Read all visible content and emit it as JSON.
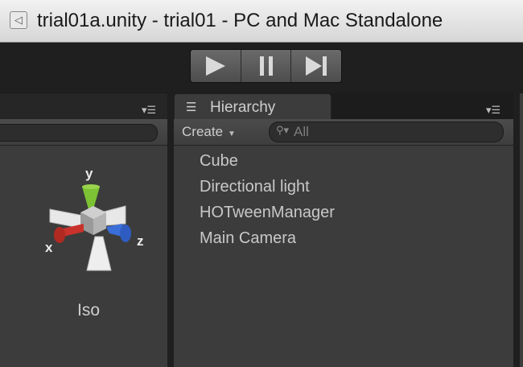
{
  "window": {
    "title": "trial01a.unity - trial01 - PC and Mac Standalone",
    "icon": "unity-document-icon"
  },
  "toolbar": {
    "play_icon": "play-icon",
    "pause_icon": "pause-icon",
    "step_icon": "step-icon"
  },
  "scene": {
    "gizmo_axes": {
      "x": "x",
      "y": "y",
      "z": "z"
    },
    "projection_label": "Iso",
    "axis_colors": {
      "x": "#c8322a",
      "y": "#7cc234",
      "z": "#3a6ed8"
    }
  },
  "hierarchy": {
    "tab_label": "Hierarchy",
    "create_label": "Create",
    "search_placeholder": "All",
    "items": [
      {
        "label": "Cube"
      },
      {
        "label": "Directional light"
      },
      {
        "label": "HOTweenManager"
      },
      {
        "label": "Main Camera"
      }
    ]
  }
}
